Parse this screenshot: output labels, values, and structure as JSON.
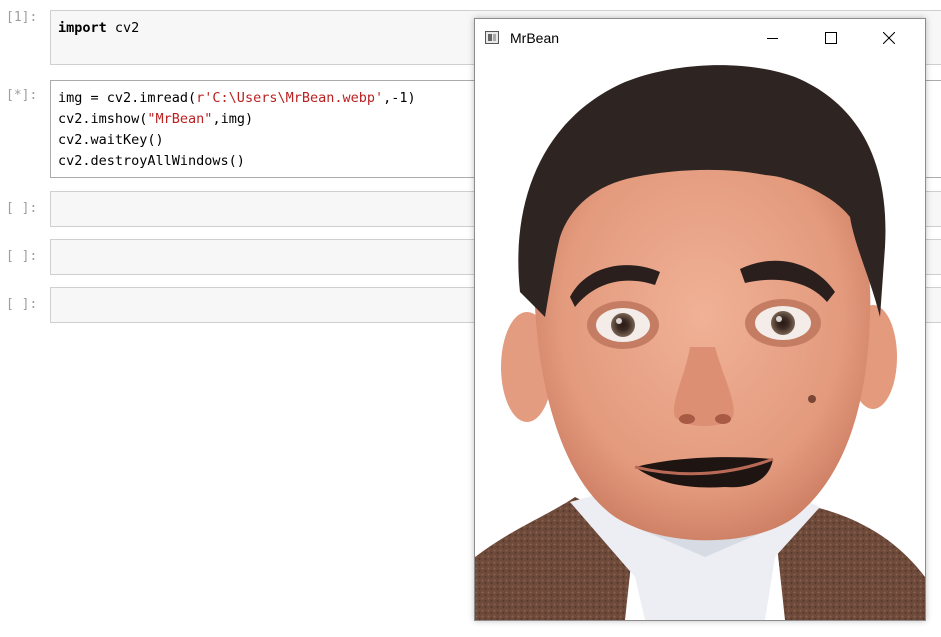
{
  "notebook": {
    "cells": [
      {
        "prompt": "[1]:",
        "code": "import cv2"
      },
      {
        "prompt": "[*]:",
        "code_lines": [
          "img = cv2.imread(r'C:\\Users\\MrBean.webp',-1)",
          "cv2.imshow(\"MrBean\",img)",
          "cv2.waitKey()",
          "cv2.destroyAllWindows()"
        ]
      },
      {
        "prompt": "[ ]:"
      },
      {
        "prompt": "[ ]:"
      },
      {
        "prompt": "[ ]:"
      }
    ]
  },
  "window": {
    "title": "MrBean",
    "image_alt": "Photo of a man with wide eyes and open-mouthed grin"
  },
  "colors": {
    "keyword": "#000000",
    "string": "#ba2121",
    "number": "#008000",
    "prompt": "#9e9e9e"
  }
}
